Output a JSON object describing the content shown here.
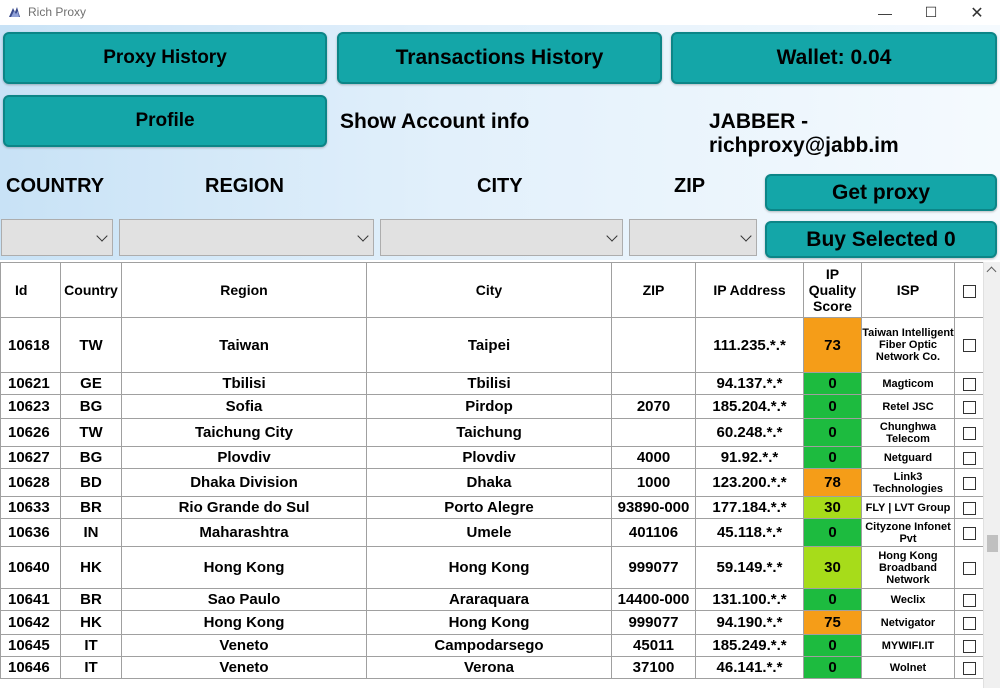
{
  "window": {
    "title": "Rich Proxy",
    "minimize_glyph": "—",
    "maximize_glyph": "☐",
    "close_glyph": "✕"
  },
  "buttons": {
    "proxy_history": "Proxy History",
    "transactions_history": "Transactions History",
    "wallet": "Wallet: 0.04",
    "profile": "Profile",
    "get_proxy": "Get proxy",
    "buy_selected": "Buy Selected 0"
  },
  "account": {
    "show_info": "Show Account info",
    "jabber": "JABBER - richproxy@jabb.im"
  },
  "filters": {
    "country_label": "COUNTRY",
    "region_label": "REGION",
    "city_label": "CITY",
    "zip_label": "ZIP"
  },
  "colors": {
    "button_teal": "#14a6a8",
    "quality_orange": "#f59d18",
    "quality_green": "#1dbb3f",
    "quality_lime": "#a7dc1a"
  },
  "table": {
    "headers": {
      "id": "Id",
      "country": "Country",
      "region": "Region",
      "city": "City",
      "zip": "ZIP",
      "ip": "IP Address",
      "quality": "IP Quality Score",
      "isp": "ISP"
    },
    "rows": [
      {
        "id": "10618",
        "country": "TW",
        "region": "Taiwan",
        "city": "Taipei",
        "zip": "",
        "ip": "111.235.*.*",
        "score": "73",
        "level": "orange",
        "isp": "Taiwan Intelligent Fiber Optic Network Co."
      },
      {
        "id": "10621",
        "country": "GE",
        "region": "Tbilisi",
        "city": "Tbilisi",
        "zip": "",
        "ip": "94.137.*.*",
        "score": "0",
        "level": "green",
        "isp": "Magticom"
      },
      {
        "id": "10623",
        "country": "BG",
        "region": "Sofia",
        "city": "Pirdop",
        "zip": "2070",
        "ip": "185.204.*.*",
        "score": "0",
        "level": "green",
        "isp": "Retel JSC"
      },
      {
        "id": "10626",
        "country": "TW",
        "region": "Taichung City",
        "city": "Taichung",
        "zip": "",
        "ip": "60.248.*.*",
        "score": "0",
        "level": "green",
        "isp": "Chunghwa Telecom"
      },
      {
        "id": "10627",
        "country": "BG",
        "region": "Plovdiv",
        "city": "Plovdiv",
        "zip": "4000",
        "ip": "91.92.*.*",
        "score": "0",
        "level": "green",
        "isp": "Netguard"
      },
      {
        "id": "10628",
        "country": "BD",
        "region": "Dhaka Division",
        "city": "Dhaka",
        "zip": "1000",
        "ip": "123.200.*.*",
        "score": "78",
        "level": "orange",
        "isp": "Link3 Technologies"
      },
      {
        "id": "10633",
        "country": "BR",
        "region": "Rio Grande do Sul",
        "city": "Porto Alegre",
        "zip": "93890-000",
        "ip": "177.184.*.*",
        "score": "30",
        "level": "lime",
        "isp": "FLY | LVT Group"
      },
      {
        "id": "10636",
        "country": "IN",
        "region": "Maharashtra",
        "city": "Umele",
        "zip": "401106",
        "ip": "45.118.*.*",
        "score": "0",
        "level": "green",
        "isp": "Cityzone Infonet Pvt"
      },
      {
        "id": "10640",
        "country": "HK",
        "region": "Hong Kong",
        "city": "Hong Kong",
        "zip": "999077",
        "ip": "59.149.*.*",
        "score": "30",
        "level": "lime",
        "isp": "Hong Kong Broadband Network"
      },
      {
        "id": "10641",
        "country": "BR",
        "region": "Sao Paulo",
        "city": "Araraquara",
        "zip": "14400-000",
        "ip": "131.100.*.*",
        "score": "0",
        "level": "green",
        "isp": "Weclix"
      },
      {
        "id": "10642",
        "country": "HK",
        "region": "Hong Kong",
        "city": "Hong Kong",
        "zip": "999077",
        "ip": "94.190.*.*",
        "score": "75",
        "level": "orange",
        "isp": "Netvigator"
      },
      {
        "id": "10645",
        "country": "IT",
        "region": "Veneto",
        "city": "Campodarsego",
        "zip": "45011",
        "ip": "185.249.*.*",
        "score": "0",
        "level": "green",
        "isp": "MYWIFI.IT"
      },
      {
        "id": "10646",
        "country": "IT",
        "region": "Veneto",
        "city": "Verona",
        "zip": "37100",
        "ip": "46.141.*.*",
        "score": "0",
        "level": "green",
        "isp": "Wolnet"
      }
    ]
  }
}
